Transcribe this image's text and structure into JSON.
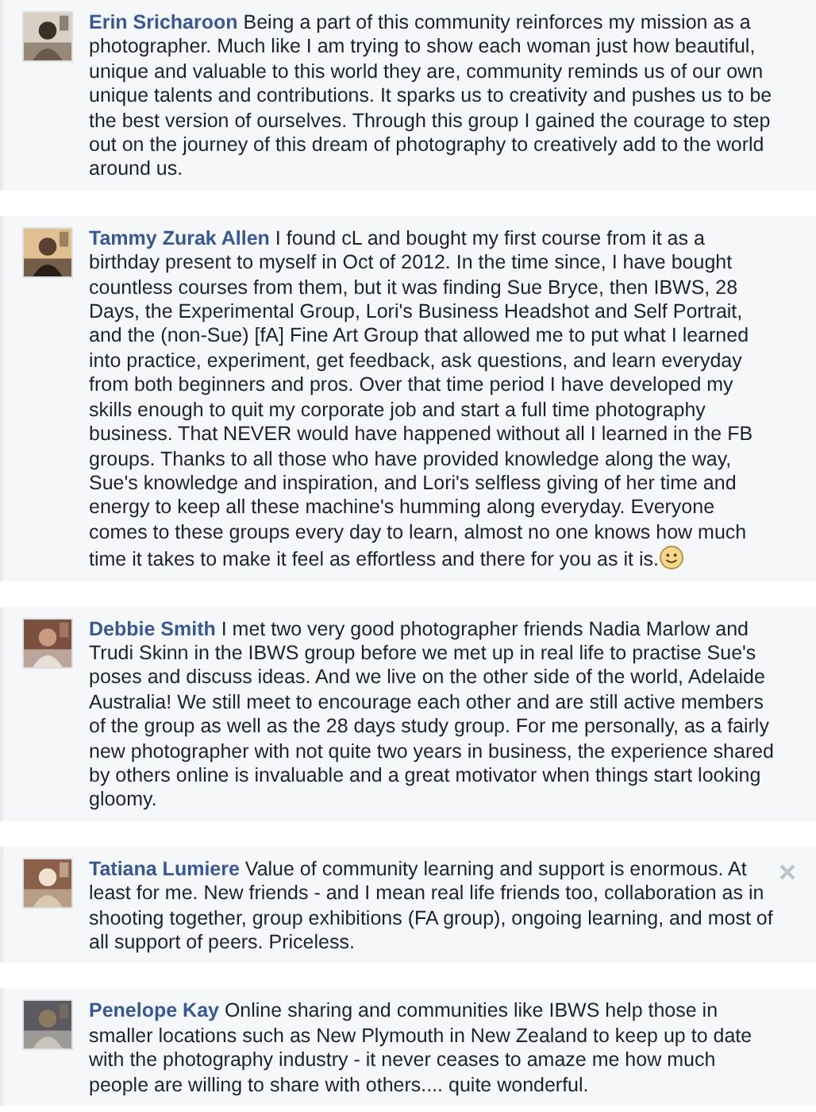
{
  "comments": [
    {
      "author": "Erin Sricharoon",
      "text": "Being a part of this community reinforces my mission as a photographer. Much like I am trying to show each woman just how beautiful, unique and valuable to this world they are, community reminds us of our own unique talents and contributions. It sparks us to creativity and pushes us to be the best version of ourselves. Through this group I gained the courage to step out on the journey of this dream of photography to creatively add to the world around us.",
      "trailing_emoticon": false,
      "close_visible": false
    },
    {
      "author": "Tammy Zurak Allen",
      "text": "I found cL and bought my first course from it as a birthday present to myself in Oct of 2012. In the time since, I have bought countless courses from them, but it was finding Sue Bryce, then IBWS, 28 Days, the Experimental Group, Lori's Business Headshot and Self Portrait, and the (non-Sue) [fA] Fine Art Group that allowed me to put what I learned into practice, experiment, get feedback, ask questions, and learn everyday from both beginners and pros. Over that time period I have developed my skills enough to quit my corporate job and start a full time photography business. That NEVER would have happened without all I learned in the FB groups. Thanks to all those who have provided knowledge along the way, Sue's knowledge and inspiration, and Lori's selfless giving of her time and energy to keep all these machine's humming along everyday. Everyone comes to these groups every day to learn, almost no one knows how much time it takes to make it feel as effortless and there for you as it is.",
      "trailing_emoticon": true,
      "close_visible": false
    },
    {
      "author": "Debbie Smith",
      "text": "I met two very good photographer friends Nadia Marlow and Trudi Skinn in the IBWS group before we met up in real life to practise Sue's poses and discuss ideas. And we live on the other side of the world, Adelaide Australia! We still meet to encourage each other and are still active members of the group as well as the 28 days study group. For me personally, as a fairly new photographer with not quite two years in business, the experience shared by others online is invaluable and a great motivator when things start looking gloomy.",
      "trailing_emoticon": false,
      "close_visible": false
    },
    {
      "author": "Tatiana Lumiere",
      "text": "Value of community learning and support is enormous. At least for me. New friends - and I mean real life friends too, collaboration as in shooting together, group exhibitions (FA group), ongoing learning, and most of all support of peers. Priceless.",
      "trailing_emoticon": false,
      "close_visible": true
    },
    {
      "author": "Penelope Kay",
      "text": "Online sharing and communities like IBWS help those in smaller locations such as New Plymouth in New Zealand to keep up to date with the photography industry - it never ceases to amaze me how much people are willing to share with others.... quite wonderful.",
      "trailing_emoticon": false,
      "close_visible": false
    }
  ]
}
